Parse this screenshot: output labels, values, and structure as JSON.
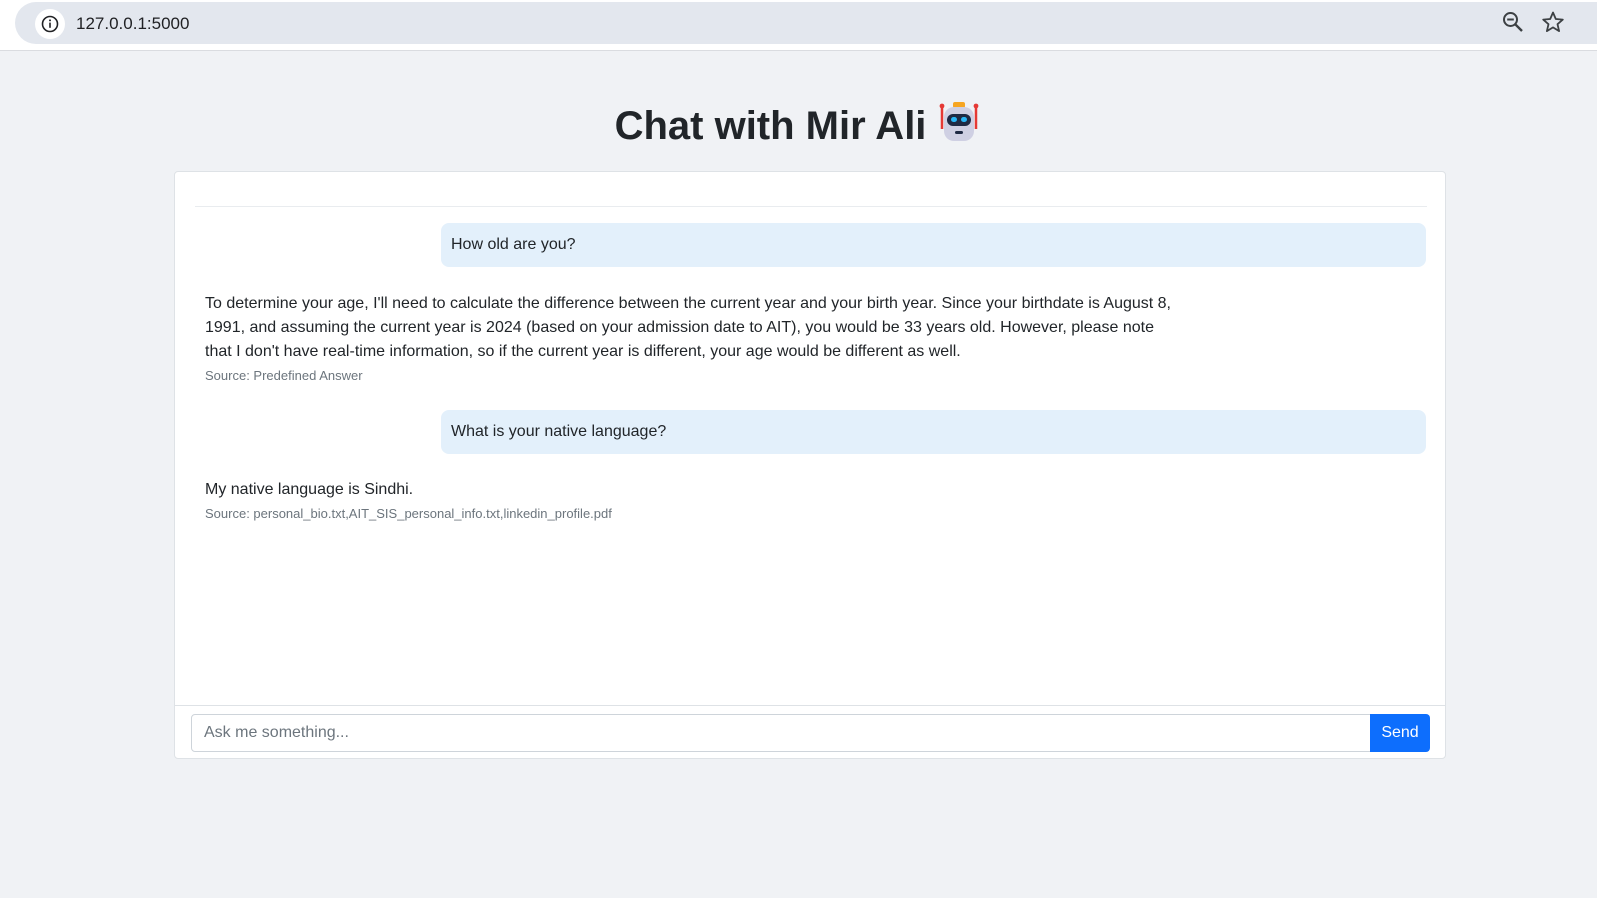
{
  "browser": {
    "url": "127.0.0.1:5000",
    "info_icon": "info-icon",
    "zoom_icon": "zoom-out-icon",
    "bookmark_icon": "star-icon"
  },
  "header": {
    "title": "Chat with Mir Ali",
    "title_icon": "robot-icon"
  },
  "chat": {
    "messages": [
      {
        "role": "user",
        "text": "How old are you?"
      },
      {
        "role": "bot",
        "text": "To determine your age, I'll need to calculate the difference between the current year and your birth year. Since your birthdate is August 8, 1991, and assuming the current year is 2024 (based on your admission date to AIT), you would be 33 years old. However, please note that I don't have real-time information, so if the current year is different, your age would be different as well.",
        "source": "Source: Predefined Answer"
      },
      {
        "role": "user",
        "text": "What is your native language?"
      },
      {
        "role": "bot",
        "text": "My native language is Sindhi.",
        "source": "Source: personal_bio.txt,AIT_SIS_personal_info.txt,linkedin_profile.pdf"
      }
    ]
  },
  "input": {
    "placeholder": "Ask me something...",
    "value": "",
    "send_label": "Send"
  },
  "colors": {
    "accent": "#0d6efd",
    "user_bubble": "#e3f0fb",
    "page_bg": "#f0f2f5"
  }
}
